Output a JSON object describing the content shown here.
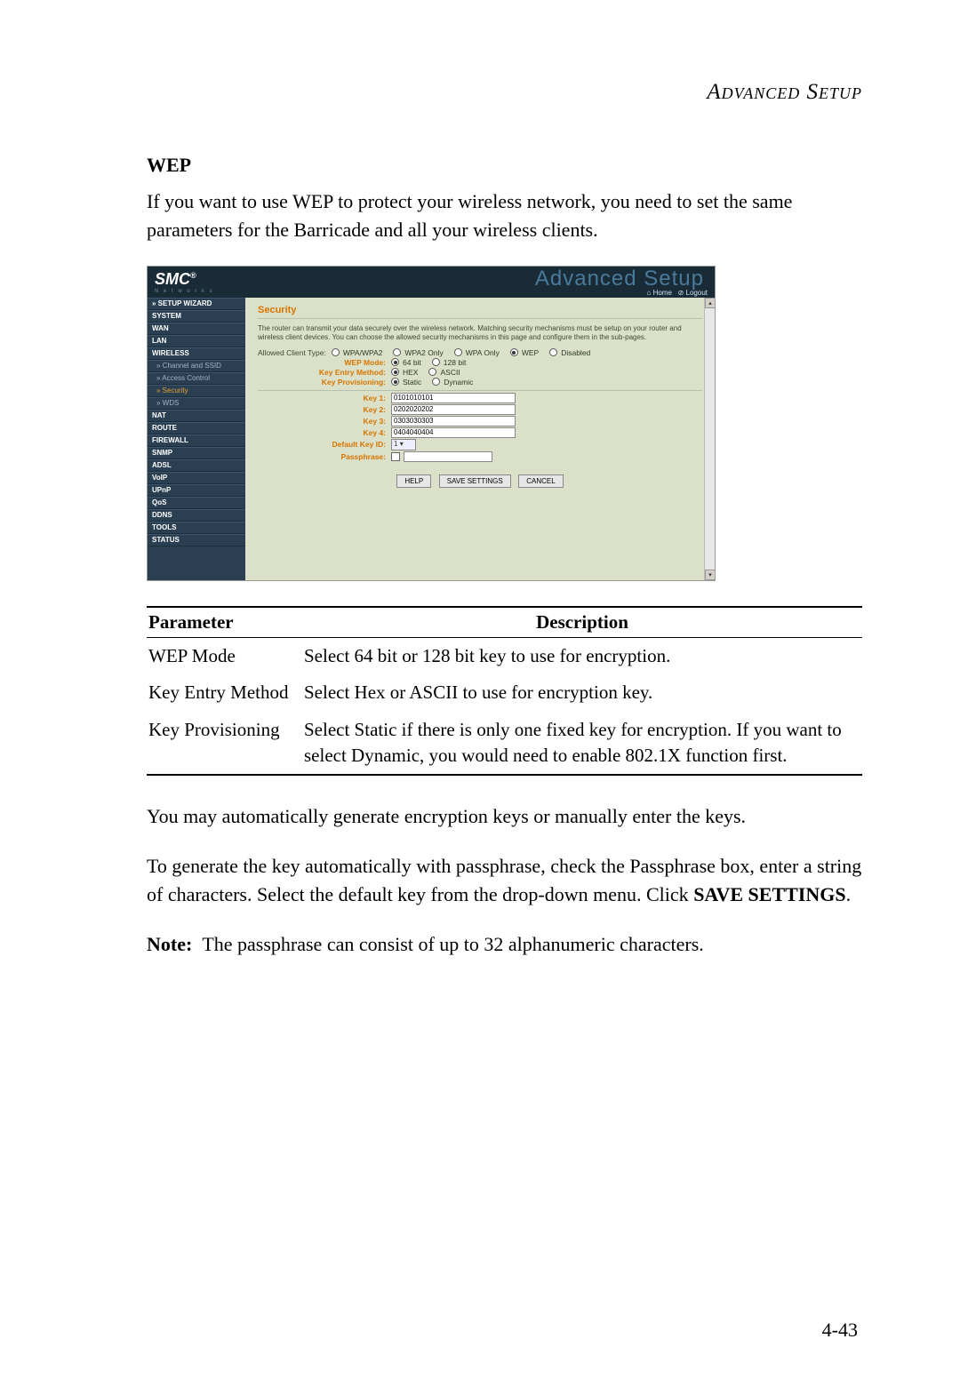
{
  "page_header": "Advanced Setup",
  "section_title": "WEP",
  "intro_text": "If you want to use WEP to protect your wireless network, you need to set the same parameters for the Barricade and all your wireless clients.",
  "screenshot": {
    "logo": "SMC",
    "logo_reg": "®",
    "logo_sub": "N e t w o r k s",
    "banner_title": "Advanced Setup",
    "home_link": "Home",
    "logout_link": "Logout",
    "sidebar": [
      {
        "label": "» SETUP WIZARD",
        "cls": "bold"
      },
      {
        "label": "SYSTEM",
        "cls": "bold"
      },
      {
        "label": "WAN",
        "cls": "bold"
      },
      {
        "label": "LAN",
        "cls": "bold"
      },
      {
        "label": "WIRELESS",
        "cls": "bold"
      },
      {
        "label": "» Channel and SSID",
        "cls": "sub"
      },
      {
        "label": "» Access Control",
        "cls": "sub"
      },
      {
        "label": "» Security",
        "cls": "sub active"
      },
      {
        "label": "» WDS",
        "cls": "sub"
      },
      {
        "label": "NAT",
        "cls": "bold"
      },
      {
        "label": "ROUTE",
        "cls": "bold"
      },
      {
        "label": "FIREWALL",
        "cls": "bold"
      },
      {
        "label": "SNMP",
        "cls": "bold"
      },
      {
        "label": "ADSL",
        "cls": "bold"
      },
      {
        "label": "VoIP",
        "cls": "bold"
      },
      {
        "label": "UPnP",
        "cls": "bold"
      },
      {
        "label": "QoS",
        "cls": "bold"
      },
      {
        "label": "DDNS",
        "cls": "bold"
      },
      {
        "label": "TOOLS",
        "cls": "bold"
      },
      {
        "label": "STATUS",
        "cls": "bold"
      }
    ],
    "main": {
      "heading": "Security",
      "description": "The router can transmit your data securely over the wireless network. Matching security mechanisms must be setup on your router and wireless client devices. You can choose the allowed security mechanisms in this page and configure them in the sub-pages.",
      "allowed_label": "Allowed Client Type:",
      "allowed_opts": [
        "WPA/WPA2",
        "WPA2 Only",
        "WPA Only",
        "WEP",
        "Disabled"
      ],
      "allowed_sel": 3,
      "wep_mode_label": "WEP Mode:",
      "wep_mode_opts": [
        "64 bit",
        "128 bit"
      ],
      "wep_mode_sel": 0,
      "key_entry_label": "Key Entry Method:",
      "key_entry_opts": [
        "HEX",
        "ASCII"
      ],
      "key_entry_sel": 0,
      "key_prov_label": "Key Provisioning:",
      "key_prov_opts": [
        "Static",
        "Dynamic"
      ],
      "key_prov_sel": 0,
      "key1_label": "Key 1:",
      "key1_val": "0101010101",
      "key2_label": "Key 2:",
      "key2_val": "0202020202",
      "key3_label": "Key 3:",
      "key3_val": "0303030303",
      "key4_label": "Key 4:",
      "key4_val": "0404040404",
      "default_key_label": "Default Key ID:",
      "default_key_val": "1",
      "passphrase_label": "Passphrase:",
      "btn_help": "HELP",
      "btn_save": "SAVE SETTINGS",
      "btn_cancel": "CANCEL"
    }
  },
  "table": {
    "head_param": "Parameter",
    "head_desc": "Description",
    "rows": [
      {
        "p": "WEP Mode",
        "d": "Select 64 bit or 128 bit key to use for encryption."
      },
      {
        "p": "Key Entry Method",
        "d": "Select Hex or ASCII to use for encryption key."
      },
      {
        "p": "Key Provisioning",
        "d": "Select Static if there is only one fixed key for encryption. If you want to select Dynamic, you would need to enable 802.1X function first."
      }
    ]
  },
  "para1": "You may automatically generate encryption keys or manually enter the keys.",
  "para2a": "To generate the key automatically with passphrase, check the Passphrase box, enter a string of characters. Select the default key from the drop-down menu. Click ",
  "para2b": "SAVE SETTINGS",
  "para2c": ".",
  "note_label": "Note:",
  "note_text": "The passphrase can consist of up to 32 alphanumeric characters.",
  "page_number": "4-43"
}
